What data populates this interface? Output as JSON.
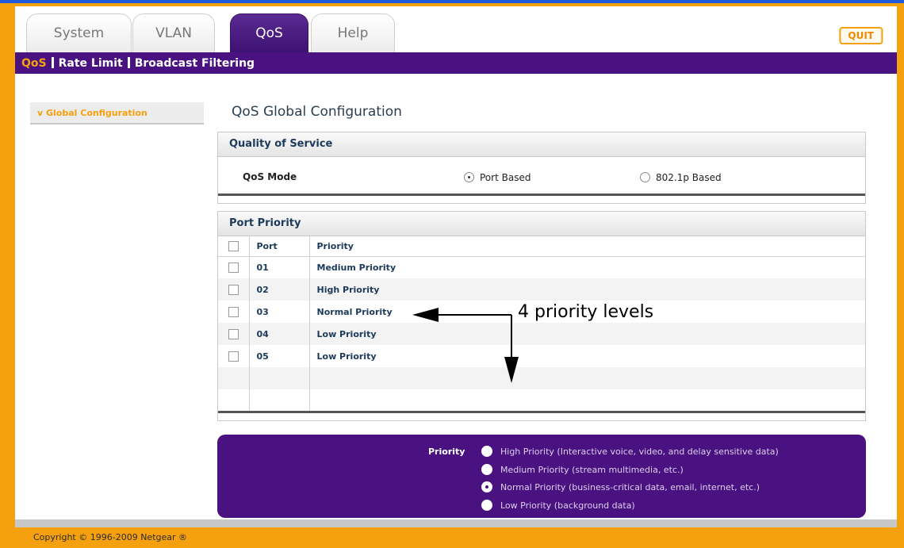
{
  "tabs": [
    {
      "label": "System"
    },
    {
      "label": "VLAN"
    },
    {
      "label": "QoS"
    },
    {
      "label": "Help"
    }
  ],
  "quit_label": "QUIT",
  "subnav": {
    "current": "QoS",
    "items": [
      "Rate Limit",
      "Broadcast Filtering"
    ]
  },
  "sidebar": {
    "item": "v Global Configuration"
  },
  "page_title": "QoS Global Configuration",
  "qos_section": {
    "title": "Quality of Service",
    "mode_label": "QoS Mode",
    "options": [
      {
        "label": "Port Based",
        "selected": true
      },
      {
        "label": "802.1p Based",
        "selected": false
      }
    ]
  },
  "port_priority": {
    "title": "Port Priority",
    "columns": [
      "Port",
      "Priority"
    ],
    "rows": [
      {
        "port": "01",
        "priority": "Medium Priority"
      },
      {
        "port": "02",
        "priority": "High Priority"
      },
      {
        "port": "03",
        "priority": "Normal Priority"
      },
      {
        "port": "04",
        "priority": "Low Priority"
      },
      {
        "port": "05",
        "priority": "Low Priority"
      }
    ]
  },
  "legend": {
    "title": "Priority",
    "items": [
      "High Priority (Interactive voice, video, and delay sensitive data)",
      "Medium Priority (stream multimedia, etc.)",
      "Normal Priority (business-critical data, email, internet, etc.)",
      "Low Priority (background data)"
    ]
  },
  "annotation": "4 priority levels",
  "footer": "Copyright © 1996-2009 Netgear ®",
  "colors": {
    "brand_purple": "#4a1280",
    "accent_orange": "#f5a10f"
  }
}
